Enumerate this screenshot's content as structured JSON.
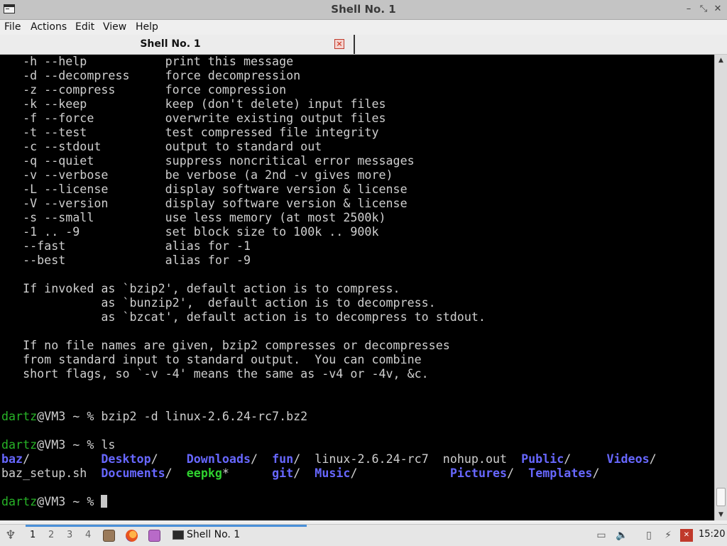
{
  "window": {
    "title": "Shell No. 1",
    "controls": [
      "–",
      "⤡",
      "✕"
    ]
  },
  "menu": [
    "File",
    "Actions",
    "Edit",
    "View",
    "Help"
  ],
  "tab": {
    "label": "Shell No. 1"
  },
  "terminal": {
    "lines": [
      [
        {
          "t": "   -h --help           print this message"
        }
      ],
      [
        {
          "t": "   -d --decompress     force decompression"
        }
      ],
      [
        {
          "t": "   -z --compress       force compression"
        }
      ],
      [
        {
          "t": "   -k --keep           keep (don't delete) input files"
        }
      ],
      [
        {
          "t": "   -f --force          overwrite existing output files"
        }
      ],
      [
        {
          "t": "   -t --test           test compressed file integrity"
        }
      ],
      [
        {
          "t": "   -c --stdout         output to standard out"
        }
      ],
      [
        {
          "t": "   -q --quiet          suppress noncritical error messages"
        }
      ],
      [
        {
          "t": "   -v --verbose        be verbose (a 2nd -v gives more)"
        }
      ],
      [
        {
          "t": "   -L --license        display software version & license"
        }
      ],
      [
        {
          "t": "   -V --version        display software version & license"
        }
      ],
      [
        {
          "t": "   -s --small          use less memory (at most 2500k)"
        }
      ],
      [
        {
          "t": "   -1 .. -9            set block size to 100k .. 900k"
        }
      ],
      [
        {
          "t": "   --fast              alias for -1"
        }
      ],
      [
        {
          "t": "   --best              alias for -9"
        }
      ],
      [
        {
          "t": ""
        }
      ],
      [
        {
          "t": "   If invoked as `bzip2', default action is to compress."
        }
      ],
      [
        {
          "t": "              as `bunzip2',  default action is to decompress."
        }
      ],
      [
        {
          "t": "              as `bzcat', default action is to decompress to stdout."
        }
      ],
      [
        {
          "t": ""
        }
      ],
      [
        {
          "t": "   If no file names are given, bzip2 compresses or decompresses"
        }
      ],
      [
        {
          "t": "   from standard input to standard output.  You can combine"
        }
      ],
      [
        {
          "t": "   short flags, so `-v -4' means the same as -v4 or -4v, &c."
        }
      ],
      [
        {
          "t": ""
        }
      ],
      [
        {
          "t": ""
        }
      ],
      [
        {
          "t": "dartz",
          "c": "green"
        },
        {
          "t": "@VM3 ~ % bzip2 -d linux-2.6.24-rc7.bz2"
        }
      ],
      [
        {
          "t": ""
        }
      ],
      [
        {
          "t": "dartz",
          "c": "green"
        },
        {
          "t": "@VM3 ~ % ls"
        }
      ],
      [
        {
          "t": "baz",
          "c": "blue"
        },
        {
          "t": "/          "
        },
        {
          "t": "Desktop",
          "c": "blue"
        },
        {
          "t": "/    "
        },
        {
          "t": "Downloads",
          "c": "blue"
        },
        {
          "t": "/  "
        },
        {
          "t": "fun",
          "c": "blue"
        },
        {
          "t": "/  linux-2.6.24-rc7  nohup.out  "
        },
        {
          "t": "Public",
          "c": "blue"
        },
        {
          "t": "/     "
        },
        {
          "t": "Videos",
          "c": "blue"
        },
        {
          "t": "/"
        }
      ],
      [
        {
          "t": "baz_setup.sh  "
        },
        {
          "t": "Documents",
          "c": "blue"
        },
        {
          "t": "/  "
        },
        {
          "t": "eepkg",
          "c": "boldgreen"
        },
        {
          "t": "*      "
        },
        {
          "t": "git",
          "c": "blue"
        },
        {
          "t": "/  "
        },
        {
          "t": "Music",
          "c": "blue"
        },
        {
          "t": "/             "
        },
        {
          "t": "Pictures",
          "c": "blue"
        },
        {
          "t": "/  "
        },
        {
          "t": "Templates",
          "c": "blue"
        },
        {
          "t": "/"
        }
      ],
      [
        {
          "t": ""
        }
      ],
      [
        {
          "t": "dartz",
          "c": "green"
        },
        {
          "t": "@VM3 ~ % "
        },
        {
          "cursor": true
        }
      ]
    ]
  },
  "taskbar": {
    "workspaces": [
      "1",
      "2",
      "3",
      "4"
    ],
    "active_workspace": "1",
    "launchers": [
      "file-manager-icon",
      "firefox-icon",
      "terminal-launcher-icon"
    ],
    "task_label": "Shell No. 1",
    "tray_icons": [
      "disk-icon",
      "volume-icon",
      "clipboard-icon",
      "network-icon",
      "keyboard-flag-icon"
    ],
    "clock": "15:20"
  }
}
